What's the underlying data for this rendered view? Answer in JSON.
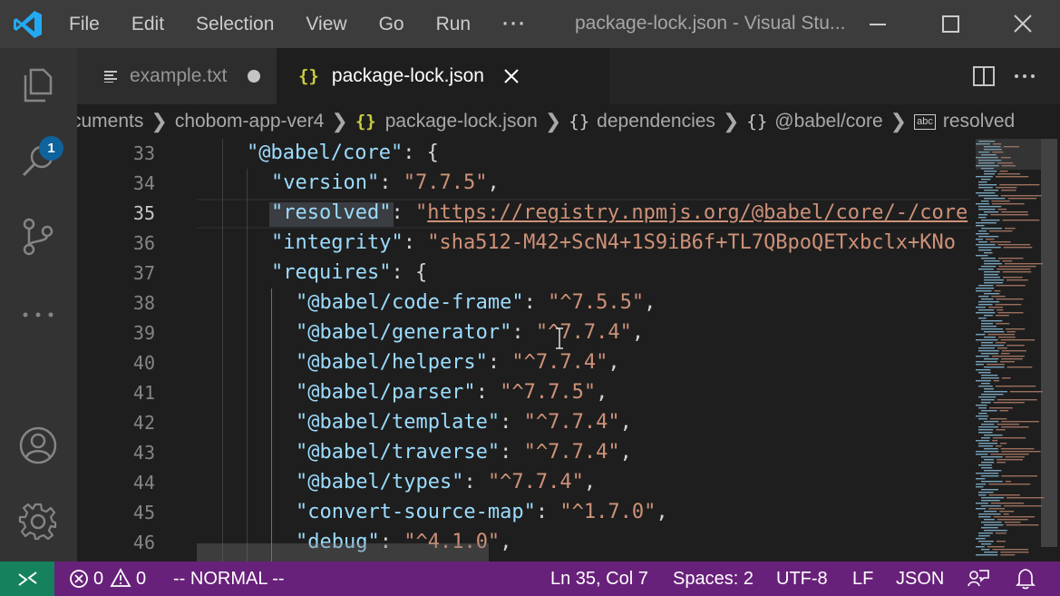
{
  "titlebar": {
    "menu": [
      "File",
      "Edit",
      "Selection",
      "View",
      "Go",
      "Run",
      "···"
    ],
    "window_title": "package-lock.json - Visual Stu..."
  },
  "activity": {
    "explorer_badge": "1"
  },
  "tabs": [
    {
      "label": "example.txt",
      "dirty": true
    },
    {
      "label": "package-lock.json",
      "active": true
    }
  ],
  "tab_icons": {
    "json": "{}"
  },
  "breadcrumb": {
    "items": [
      "cuments",
      "chobom-app-ver4",
      "package-lock.json",
      "dependencies",
      "@babel/core",
      "resolved"
    ],
    "abc": "abc"
  },
  "editor": {
    "lines": [
      {
        "n": "33",
        "key": "\"@babel/core\"",
        "sep": ": {",
        "val": "",
        "tail": ""
      },
      {
        "n": "34",
        "key": "\"version\"",
        "sep": ": ",
        "val": "\"7.7.5\"",
        "tail": ","
      },
      {
        "n": "35",
        "key": "\"resolved\"",
        "sep": ": ",
        "val": "\"https://registry.npmjs.org/@babel/core/-/core",
        "tail": ""
      },
      {
        "n": "36",
        "key": "\"integrity\"",
        "sep": ": ",
        "val": "\"sha512-M42+ScN4+1S9iB6f+TL7QBpoQETxbclx+KNo",
        "tail": ""
      },
      {
        "n": "37",
        "key": "\"requires\"",
        "sep": ": {",
        "val": "",
        "tail": ""
      },
      {
        "n": "38",
        "key": "\"@babel/code-frame\"",
        "sep": ": ",
        "val": "\"^7.5.5\"",
        "tail": ","
      },
      {
        "n": "39",
        "key": "\"@babel/generator\"",
        "sep": ": ",
        "val": "\"^7.7.4\"",
        "tail": ","
      },
      {
        "n": "40",
        "key": "\"@babel/helpers\"",
        "sep": ": ",
        "val": "\"^7.7.4\"",
        "tail": ","
      },
      {
        "n": "41",
        "key": "\"@babel/parser\"",
        "sep": ": ",
        "val": "\"^7.7.5\"",
        "tail": ","
      },
      {
        "n": "42",
        "key": "\"@babel/template\"",
        "sep": ": ",
        "val": "\"^7.7.4\"",
        "tail": ","
      },
      {
        "n": "43",
        "key": "\"@babel/traverse\"",
        "sep": ": ",
        "val": "\"^7.7.4\"",
        "tail": ","
      },
      {
        "n": "44",
        "key": "\"@babel/types\"",
        "sep": ": ",
        "val": "\"^7.7.4\"",
        "tail": ","
      },
      {
        "n": "45",
        "key": "\"convert-source-map\"",
        "sep": ": ",
        "val": "\"^1.7.0\"",
        "tail": ","
      },
      {
        "n": "46",
        "key": "\"debug\"",
        "sep": ": ",
        "val": "\"^4.1.0\"",
        "tail": ","
      }
    ],
    "current_line": "35"
  },
  "status": {
    "errors": "0",
    "warnings": "0",
    "mode": "-- NORMAL --",
    "position": "Ln 35, Col 7",
    "spaces": "Spaces: 2",
    "encoding": "UTF-8",
    "eol": "LF",
    "language": "JSON"
  },
  "colors": {
    "status_bar": "#68217a",
    "remote": "#16825d",
    "json_key": "#9cdcfe",
    "json_string": "#ce9178",
    "badge": "#0e639c"
  }
}
